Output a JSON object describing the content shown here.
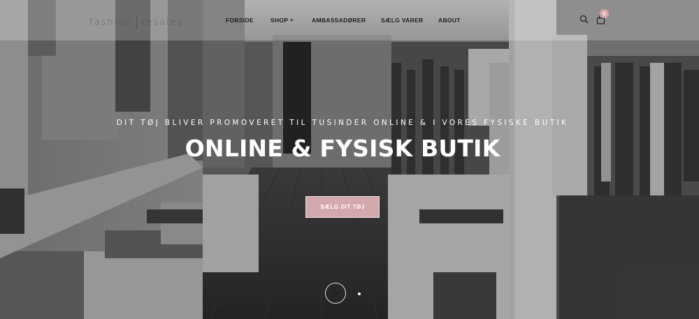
{
  "brand": {
    "logo_left": "fashion",
    "logo_right": "resales"
  },
  "nav": {
    "items": [
      {
        "label": "FORSIDE"
      },
      {
        "label": "SHOP"
      },
      {
        "label": "AMBASSADØRER"
      },
      {
        "label": "SÆLG VARER"
      },
      {
        "label": "ABOUT"
      }
    ]
  },
  "header": {
    "cart_count": "0",
    "search_icon": "search-icon",
    "cart_icon": "shopping-bag-icon"
  },
  "hero": {
    "subtitle": "DIT TØJ BLIVER PROMOVERET TIL TUSINDER ONLINE & I VORES FYSISKE BUTIK",
    "title": "ONLINE & FYSISK BUTIK",
    "cta_label": "SÆLG DIT TØJ"
  },
  "slider": {
    "slides": 2,
    "active": 1
  },
  "colors": {
    "accent": "#d4a9ad",
    "nav_text": "#1c1c1c",
    "hero_text": "#ffffff"
  }
}
